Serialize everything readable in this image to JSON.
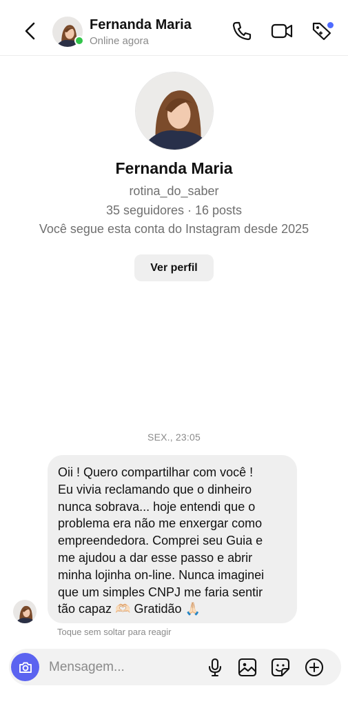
{
  "header": {
    "name": "Fernanda Maria",
    "status": "Online agora",
    "icons": [
      "back-arrow-icon",
      "phone-icon",
      "video-camera-icon",
      "tag-icon"
    ],
    "online_color": "#31c44a",
    "notification_color": "#4f6bff"
  },
  "profile": {
    "name": "Fernanda Maria",
    "username": "rotina_do_saber",
    "stats": "35 seguidores · 16 posts",
    "follow_info": "Você segue esta conta do Instagram desde 2025",
    "view_button": "Ver perfil"
  },
  "chat": {
    "timestamp": "SEX., 23:05",
    "message_lines": [
      "Oii ! Quero compartilhar com você !",
      "Eu vivia reclamando que o dinheiro",
      "nunca sobrava... hoje entendi que o",
      "problema era não me enxergar como",
      "empreendedora. Comprei seu Guia e",
      "me ajudou a dar esse passo e abrir",
      "minha lojinha on-line. Nunca imaginei",
      "que um simples CNPJ me faria sentir",
      "tão capaz 🫶🏻 Gratidão 🙏🏻"
    ],
    "react_hint": "Toque sem soltar para reagir"
  },
  "composer": {
    "placeholder": "Mensagem...",
    "icons": [
      "camera-icon",
      "microphone-icon",
      "image-icon",
      "sticker-icon",
      "plus-icon"
    ],
    "camera_color": "#5b63f0"
  }
}
